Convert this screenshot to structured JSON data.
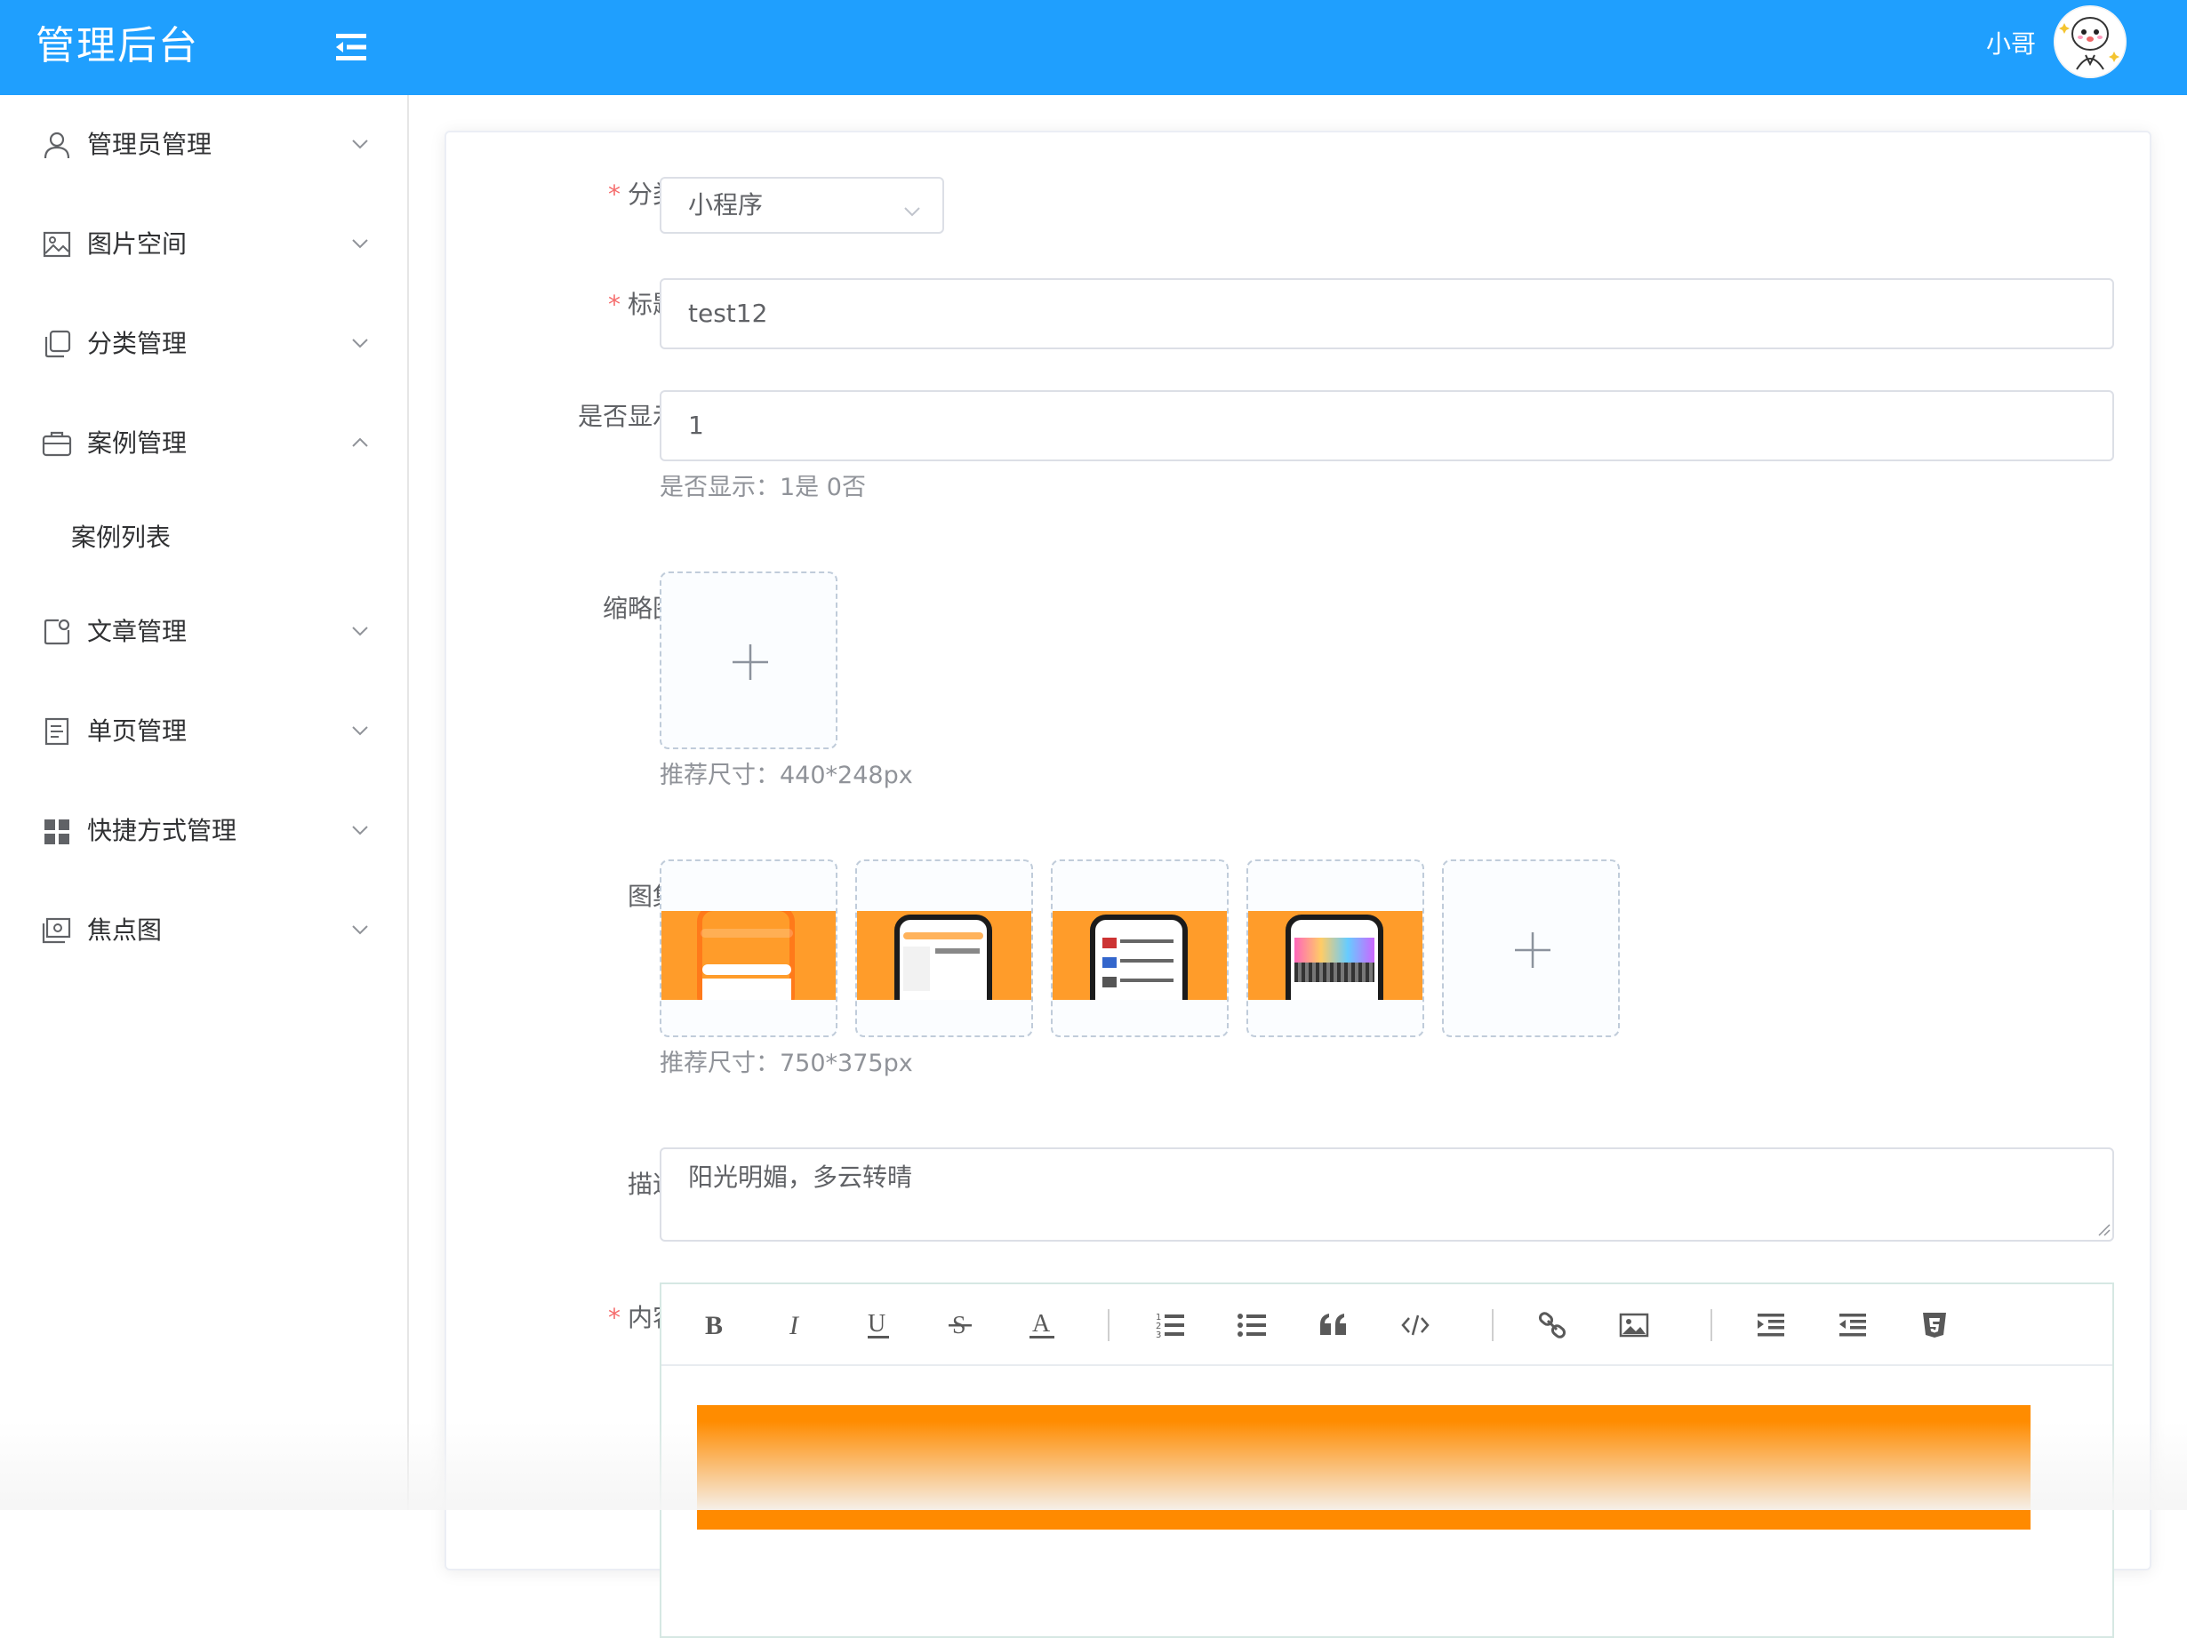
{
  "app": {
    "title": "管理后台"
  },
  "header": {
    "user_name": "小哥"
  },
  "sidebar": {
    "items": [
      {
        "label": "管理员管理",
        "icon": "user-icon",
        "expanded": false
      },
      {
        "label": "图片空间",
        "icon": "image-icon",
        "expanded": false
      },
      {
        "label": "分类管理",
        "icon": "copy-icon",
        "expanded": false
      },
      {
        "label": "案例管理",
        "icon": "briefcase-icon",
        "expanded": true,
        "children": [
          {
            "label": "案例列表"
          }
        ]
      },
      {
        "label": "文章管理",
        "icon": "article-icon",
        "expanded": false
      },
      {
        "label": "单页管理",
        "icon": "page-icon",
        "expanded": false
      },
      {
        "label": "快捷方式管理",
        "icon": "grid-icon",
        "expanded": false
      },
      {
        "label": "焦点图",
        "icon": "focus-image-icon",
        "expanded": false
      }
    ]
  },
  "form": {
    "category": {
      "label": "分类",
      "required": true,
      "value": "小程序"
    },
    "title": {
      "label": "标题",
      "required": true,
      "value": "test12"
    },
    "show": {
      "label": "是否显示",
      "value": "1",
      "hint": "是否显示：1是 0否"
    },
    "thumbnail": {
      "label": "缩略图",
      "hint": "推荐尺寸：440*248px"
    },
    "gallery": {
      "label": "图集",
      "hint": "推荐尺寸：750*375px",
      "images": [
        {
          "name": "gallery-image-1"
        },
        {
          "name": "gallery-image-2"
        },
        {
          "name": "gallery-image-3"
        },
        {
          "name": "gallery-image-4"
        }
      ]
    },
    "description": {
      "label": "描述",
      "value": "阳光明媚，多云转晴"
    },
    "content": {
      "label": "内容",
      "required": true,
      "toolbar": [
        "bold-icon",
        "italic-icon",
        "underline-icon",
        "strikethrough-icon",
        "font-color-icon",
        "ordered-list-icon",
        "unordered-list-icon",
        "quote-icon",
        "code-icon",
        "link-icon",
        "image-icon",
        "indent-icon",
        "outdent-icon",
        "html5-icon"
      ]
    }
  },
  "colors": {
    "header": "#1f9ffe",
    "required": "#f56c6c",
    "content_banner": "#ff8c00"
  }
}
